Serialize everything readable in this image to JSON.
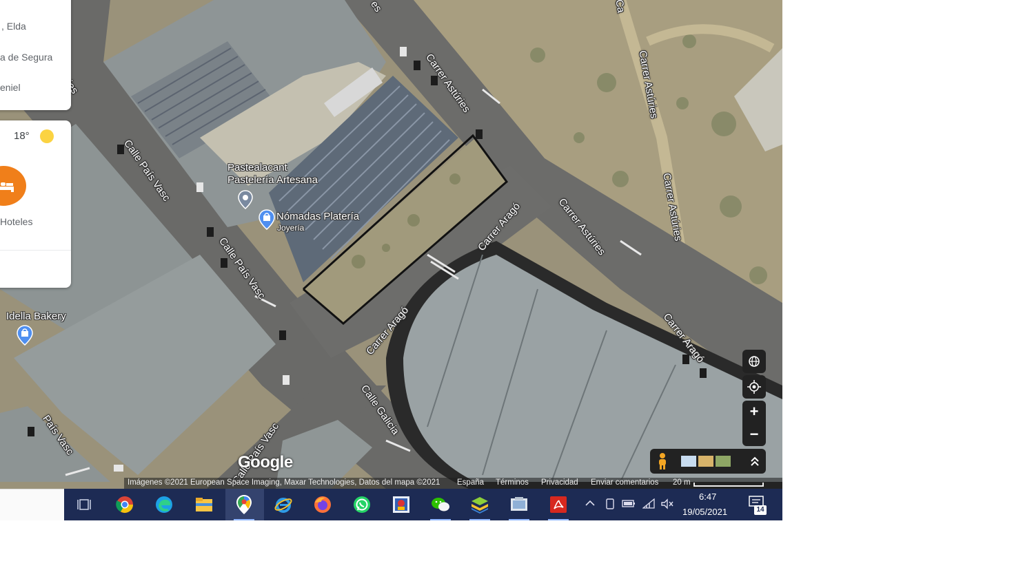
{
  "map": {
    "streets": [
      {
        "text": "Carrer Astúries"
      },
      {
        "text": "Carrer Astúries"
      },
      {
        "text": "Carrer Astúries"
      },
      {
        "text": "Carrer Astúries"
      },
      {
        "text": "Carrer Aragó"
      },
      {
        "text": "Carrer Aragó"
      },
      {
        "text": "Carrer Aragó"
      },
      {
        "text": "Calle País Vasc"
      },
      {
        "text": "Calle País Vasc"
      },
      {
        "text": "Calle País Vasc"
      },
      {
        "text": "Calle Galicia"
      },
      {
        "text": "País Vasc"
      },
      {
        "text": "ries"
      },
      {
        "text": "es"
      },
      {
        "text": "Ca"
      }
    ],
    "places": {
      "pastealacant_line1": "Pastealacant",
      "pastealacant_line2": "Pastelería Artesana",
      "nomadas_name": "Nómadas Platería",
      "nomadas_category": "Joyería",
      "idella_name": "Idella Bakery"
    },
    "google_logo": "Google",
    "attribution": {
      "imagery": "Imágenes ©2021 European Space Imaging, Maxar Technologies, Datos del mapa ©2021",
      "country": "España",
      "terms": "Términos",
      "privacy": "Privacidad",
      "feedback": "Enviar comentarios",
      "scale": "20 m"
    }
  },
  "side_panel": {
    "recent": [
      ", Elda",
      "a de Segura",
      "eniel"
    ],
    "weather_temp": "18°",
    "hotels_label": "Hoteles"
  },
  "controls": {
    "zoom_in": "+",
    "zoom_out": "−"
  },
  "taskbar": {
    "time": "6:47",
    "date": "19/05/2021",
    "notifications": "14",
    "apps": [
      "task-view",
      "chrome",
      "edge",
      "file-explorer",
      "google-maps",
      "internet-explorer",
      "firefox",
      "whatsapp",
      "photo-app",
      "wechat",
      "bluestacks",
      "notes",
      "acrobat"
    ]
  },
  "colors": {
    "taskbar": "#1d2b54",
    "plot_outline": "#111111",
    "hotel_button": "#f07f1a",
    "sun": "#fbd342"
  }
}
